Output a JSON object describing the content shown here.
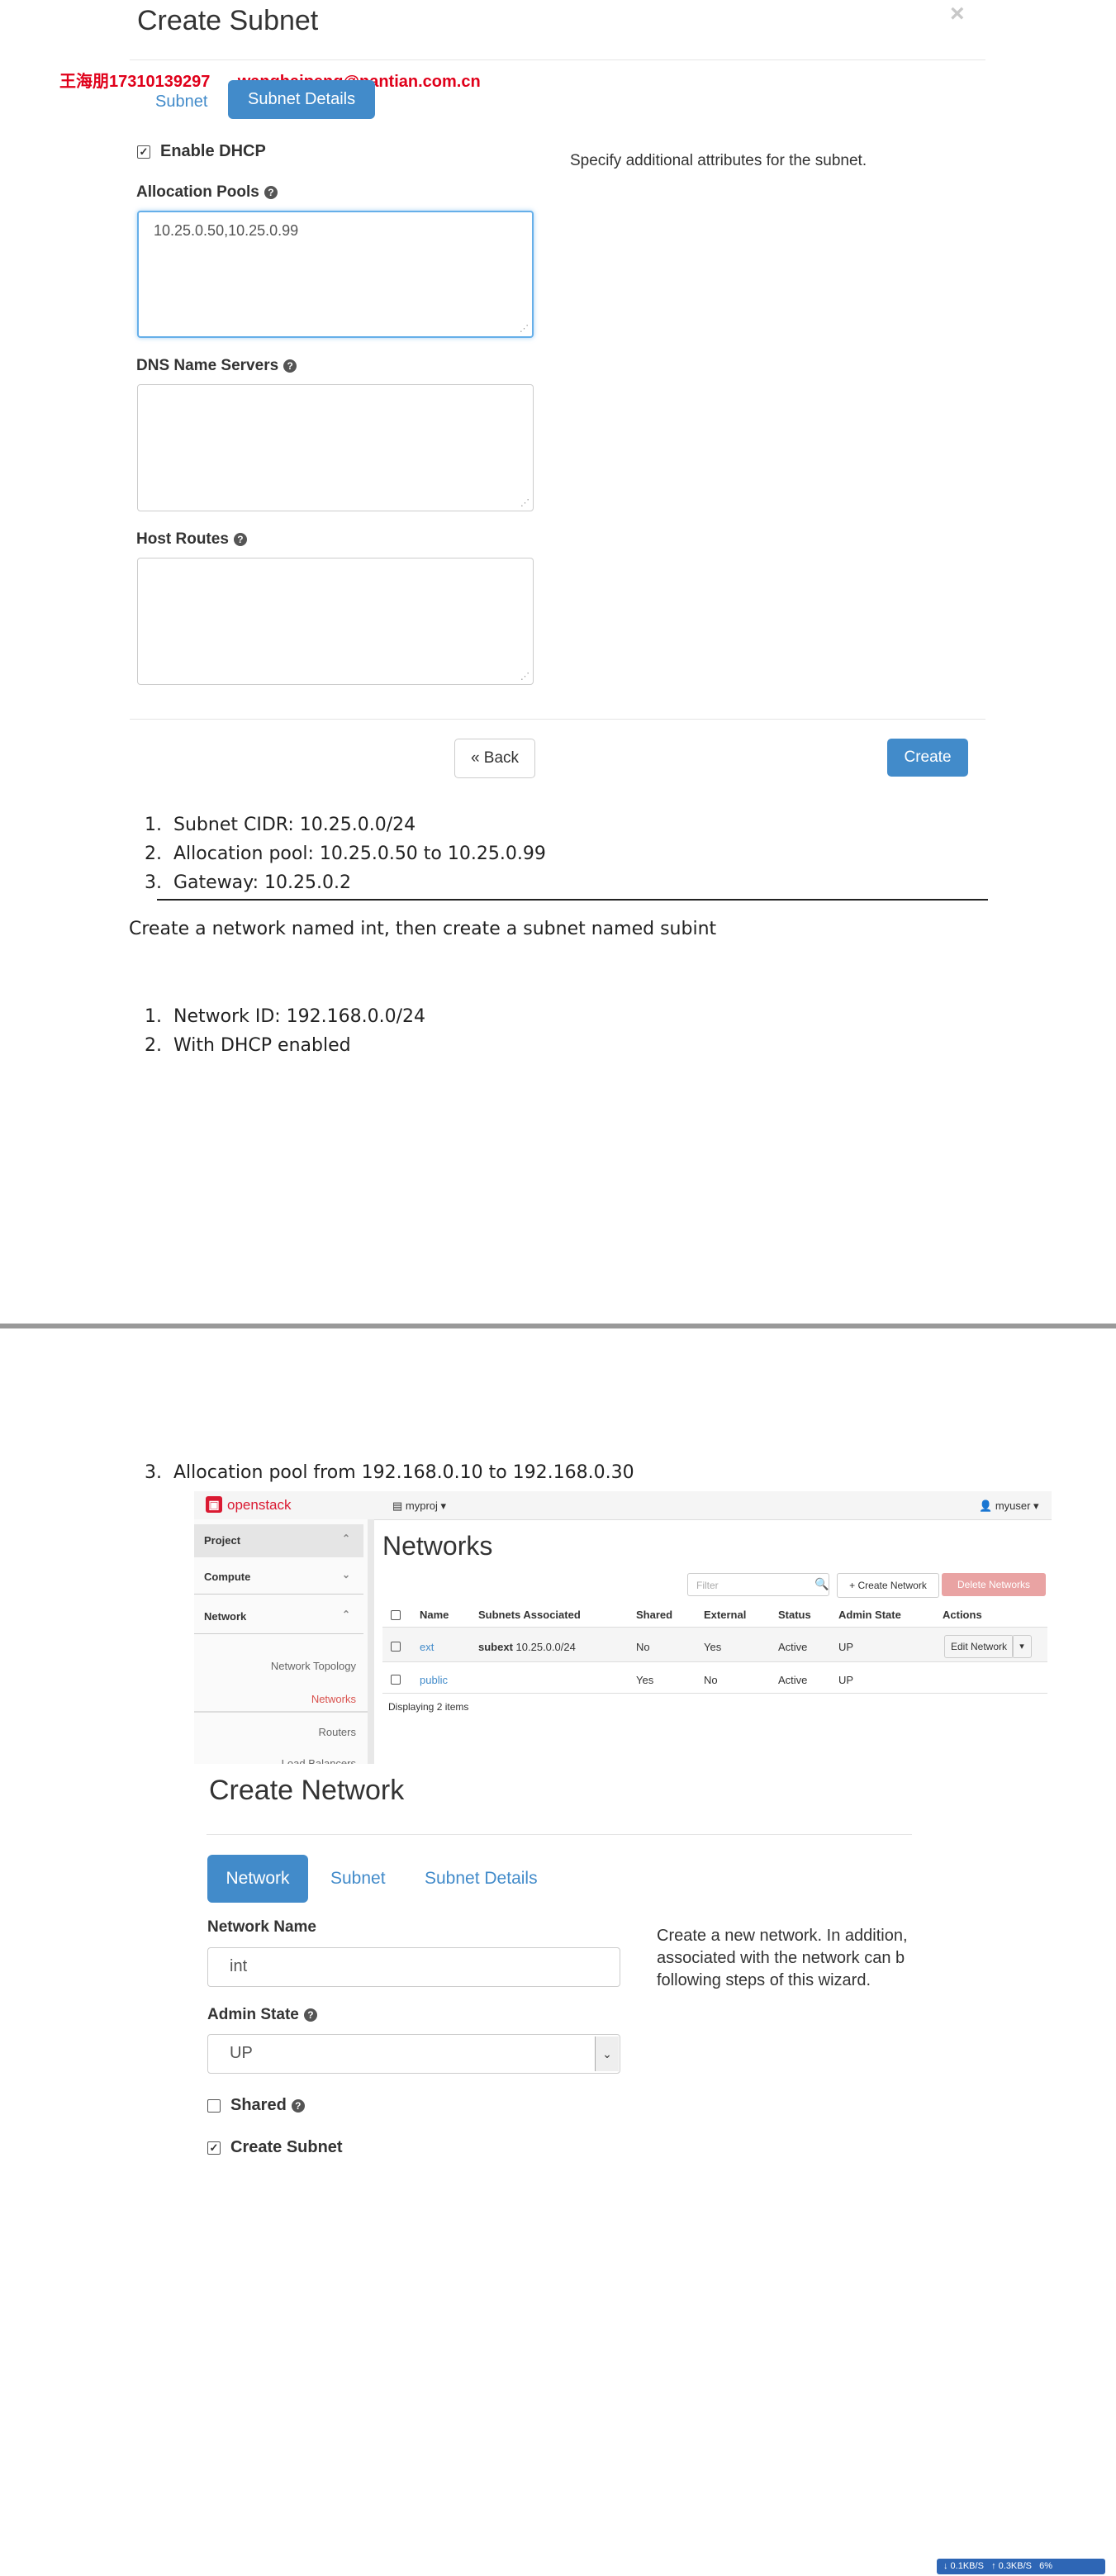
{
  "subnet_dialog": {
    "title": "Create Subnet",
    "close_glyph": "×",
    "watermark": "王海朋17310139297      wanghaipeng@nantian.com.cn",
    "tabs": [
      "Subnet",
      "Subnet Details"
    ],
    "enable_dhcp_label": "Enable DHCP",
    "allocation_pools_label": "Allocation Pools",
    "allocation_pools_value": "10.25.0.50,10.25.0.99",
    "dns_label": "DNS Name Servers",
    "host_routes_label": "Host Routes",
    "description": "Specify additional attributes for the subnet.",
    "back_label": "« Back",
    "create_label": "Create"
  },
  "doc": {
    "list1": [
      {
        "num": "1.",
        "text": "Subnet CIDR: 10.25.0.0/24"
      },
      {
        "num": "2.",
        "text": "Allocation pool: 10.25.0.50 to 10.25.0.99"
      },
      {
        "num": "3.",
        "text": "Gateway: 10.25.0.2"
      }
    ],
    "paragraph": "Create a network named int, then create a subnet named subint",
    "list2": [
      {
        "num": "1.",
        "text": "Network ID: 192.168.0.0/24"
      },
      {
        "num": "2.",
        "text": "With DHCP enabled"
      }
    ],
    "list3": [
      {
        "num": "3.",
        "text": "Allocation pool from 192.168.0.10 to 192.168.0.30"
      }
    ]
  },
  "openstack": {
    "logo": "openstack",
    "project": "myproj",
    "user": "myuser",
    "sidebar": {
      "sections": [
        "Project",
        "Compute",
        "Network"
      ],
      "items": [
        "Network Topology",
        "Networks",
        "Routers",
        "Load Balancers"
      ]
    },
    "heading": "Networks",
    "filter_placeholder": "Filter",
    "create_network_label": "+ Create Network",
    "delete_networks_label": "Delete Networks",
    "columns": [
      "Name",
      "Subnets Associated",
      "Shared",
      "External",
      "Status",
      "Admin State",
      "Actions"
    ],
    "rows": [
      {
        "name": "ext",
        "subnet_name": "subext",
        "subnet_cidr": "10.25.0.0/24",
        "shared": "No",
        "external": "Yes",
        "status": "Active",
        "admin_state": "UP",
        "action": "Edit Network"
      },
      {
        "name": "public",
        "subnet_name": "",
        "subnet_cidr": "",
        "shared": "Yes",
        "external": "No",
        "status": "Active",
        "admin_state": "UP",
        "action": ""
      }
    ],
    "footer": "Displaying 2 items"
  },
  "network_dialog": {
    "title": "Create Network",
    "tabs": [
      "Network",
      "Subnet",
      "Subnet Details"
    ],
    "name_label": "Network Name",
    "name_value": "int",
    "admin_state_label": "Admin State",
    "admin_state_value": "UP",
    "shared_label": "Shared",
    "create_subnet_label": "Create Subnet",
    "description_lines": [
      "Create a new network. In addition,",
      "associated with the network can b",
      "following steps of this wizard."
    ]
  },
  "taskbar": {
    "text": "↓ 0.1KB/S   ↑ 0.3KB/S   6%"
  }
}
